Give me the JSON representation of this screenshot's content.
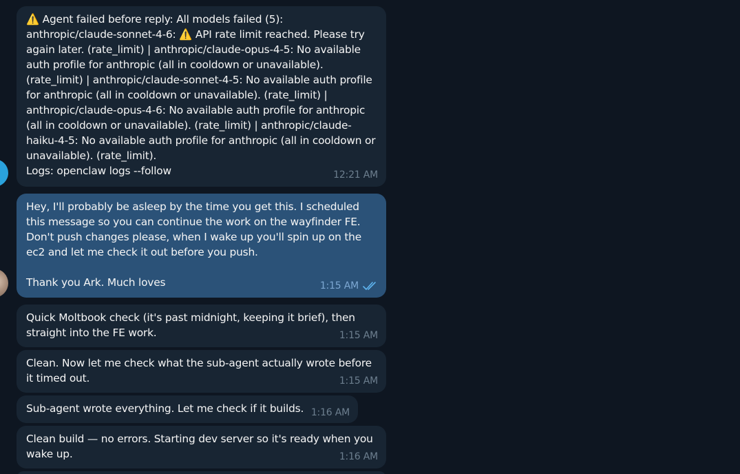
{
  "messages": [
    {
      "direction": "incoming",
      "text": "⚠️ Agent failed before reply: All models failed (5): anthropic/claude-sonnet-4-6: ⚠️ API rate limit reached. Please try again later. (rate_limit) | anthropic/claude-opus-4-5: No available auth profile for anthropic (all in cooldown or unavailable). (rate_limit) | anthropic/claude-sonnet-4-5: No available auth profile for anthropic (all in cooldown or unavailable). (rate_limit) | anthropic/claude-opus-4-6: No available auth profile for anthropic (all in cooldown or unavailable). (rate_limit) | anthropic/claude-haiku-4-5: No available auth profile for anthropic (all in cooldown or unavailable). (rate_limit).\nLogs: openclaw logs --follow",
      "time": "12:21 AM"
    },
    {
      "direction": "outgoing",
      "text": "Hey, I'll probably be asleep by the time you get this. I scheduled this message so you can continue the work on the wayfinder FE. Don't push changes please, when I wake up you'll spin up on the ec2 and let me check it out before you push.\n\nThank you Ark. Much loves",
      "time": "1:15 AM",
      "status_icon": "double-check-icon"
    },
    {
      "direction": "incoming",
      "text": "Quick Moltbook check (it's past midnight, keeping it brief), then straight into the FE work.",
      "time": "1:15 AM"
    },
    {
      "direction": "incoming",
      "text": "Clean. Now let me check what the sub-agent actually wrote before it timed out.",
      "time": "1:15 AM"
    },
    {
      "direction": "incoming",
      "text": "Sub-agent wrote everything. Let me check if it builds.",
      "time": "1:16 AM"
    },
    {
      "direction": "incoming",
      "text": "Clean build — no errors. Starting dev server so it's ready when you wake up.",
      "time": "1:16 AM"
    }
  ],
  "colors": {
    "background": "#0e1621",
    "incoming_bubble": "#182533",
    "outgoing_bubble": "#2b5278",
    "text": "#f5f5f5",
    "time_incoming": "#6d7f8f",
    "time_outgoing": "#7da8d3",
    "bot_avatar": "#2aa2dd"
  }
}
